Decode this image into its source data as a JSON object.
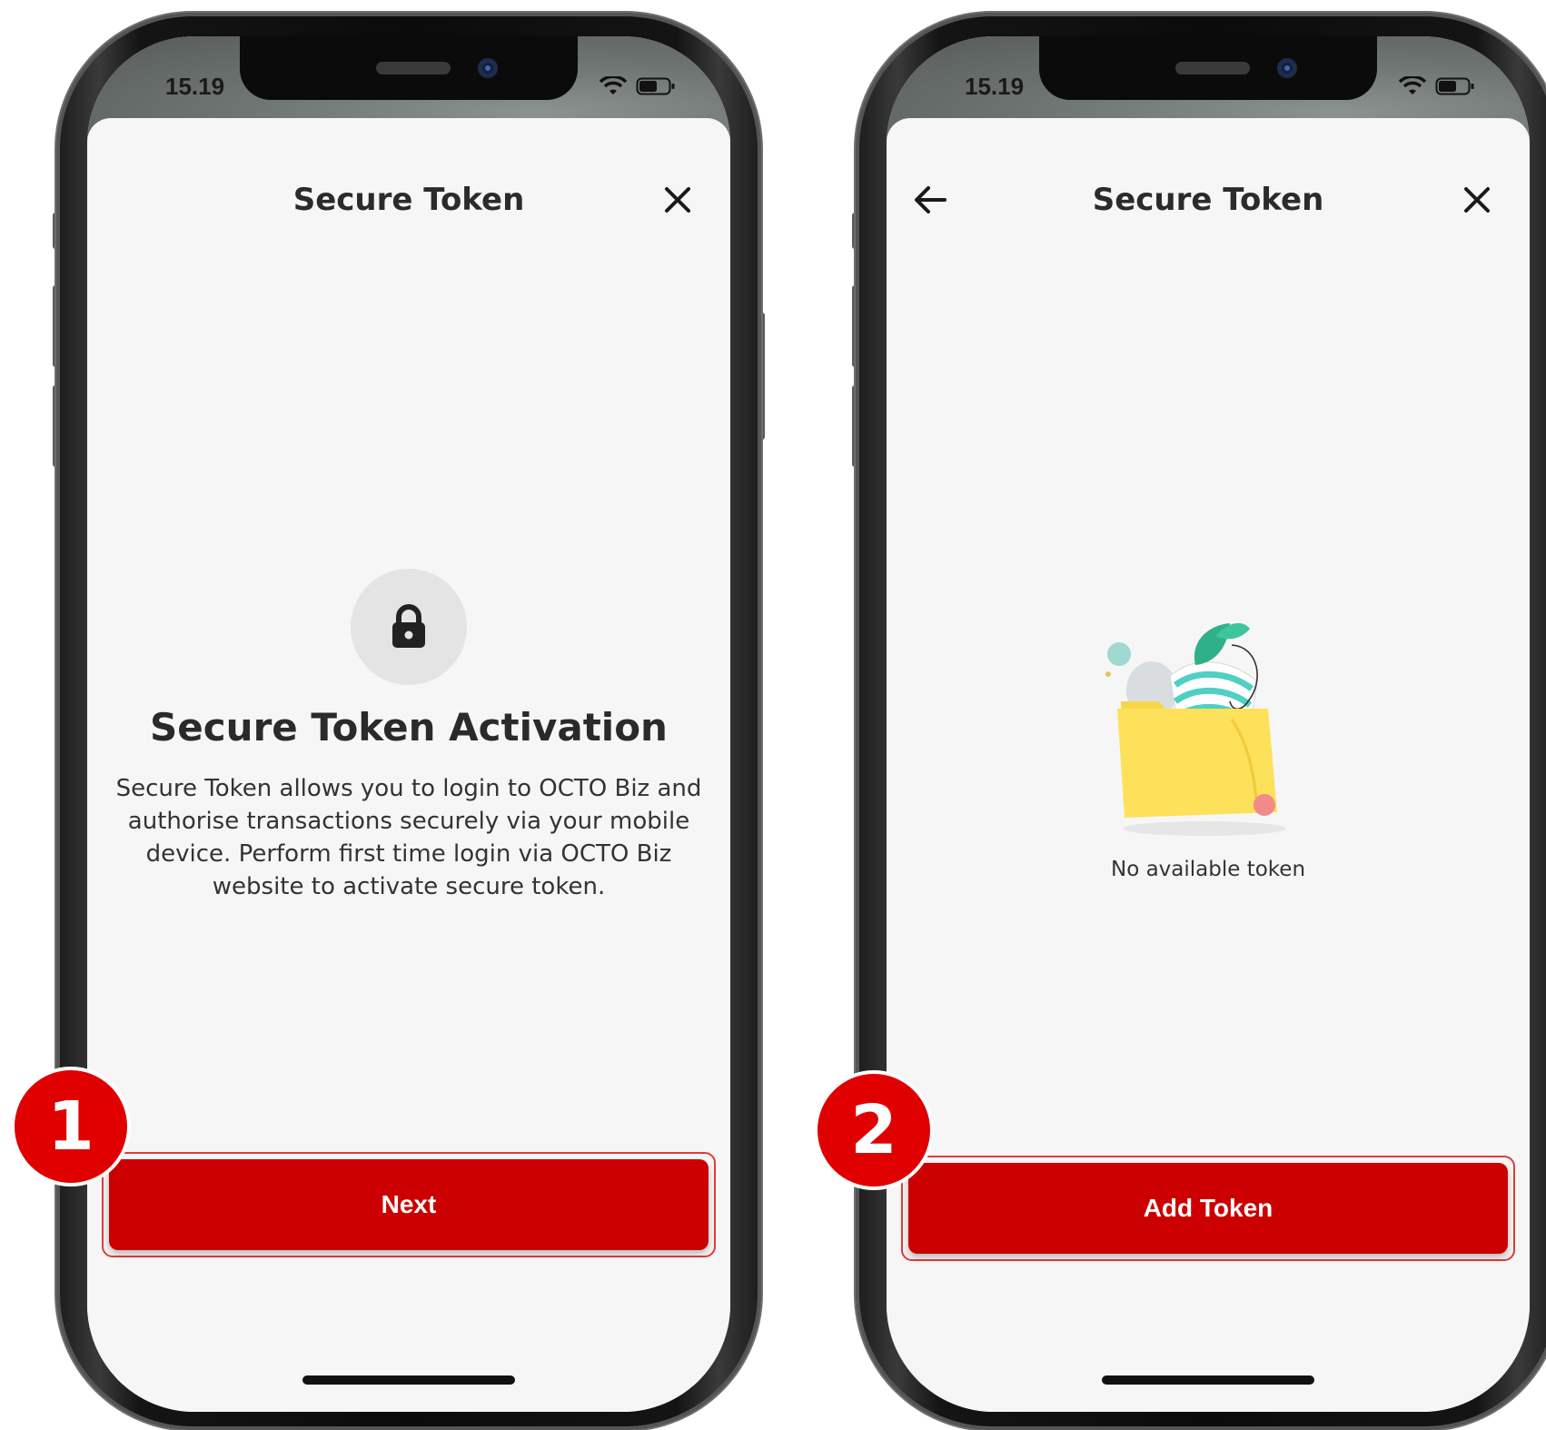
{
  "status_bar": {
    "time": "15.19"
  },
  "screen1": {
    "title": "Secure Token",
    "heading": "Secure Token Activation",
    "description": "Secure Token allows you to login to OCTO Biz and authorise transactions securely via your mobile device. Perform first time login via OCTO Biz website to activate secure token.",
    "button_label": "Next",
    "step_number": "1"
  },
  "screen2": {
    "title": "Secure Token",
    "empty_message": "No available token",
    "button_label": "Add Token",
    "step_number": "2"
  },
  "colors": {
    "primary_red": "#cc0000",
    "badge_red": "#e00000",
    "highlight_outline": "#e23b3b",
    "screen_bg": "#f6f6f6"
  },
  "icons": [
    "close-icon",
    "back-arrow-icon",
    "lock-icon",
    "wifi-icon",
    "battery-icon",
    "folder-illustration"
  ]
}
